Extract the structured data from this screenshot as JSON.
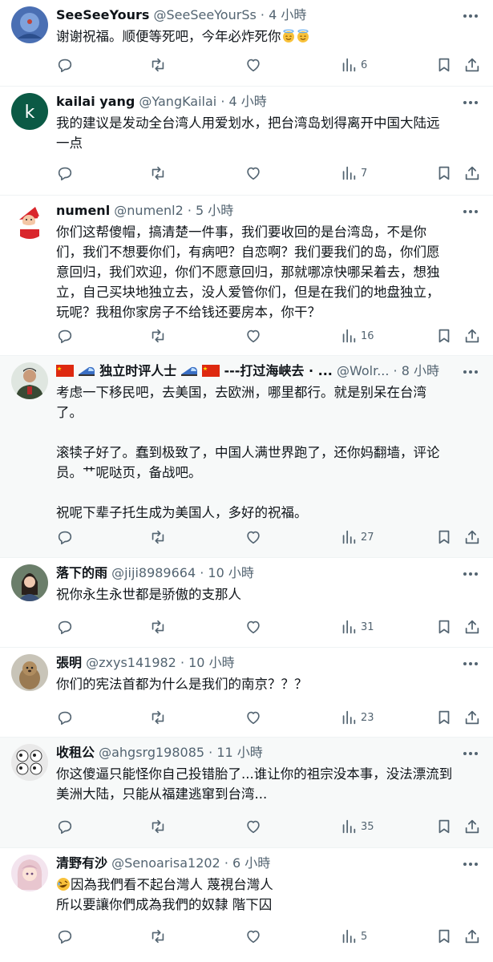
{
  "colors": {
    "text": "#0f1419",
    "secondary": "#536471",
    "divider": "#eff3f4",
    "shaded_bg": "#f7f9f9"
  },
  "icons": {
    "reply": "reply-icon",
    "retweet": "retweet-icon",
    "like": "heart-icon",
    "views": "views-icon",
    "bookmark": "bookmark-icon",
    "share": "share-icon",
    "more": "more-icon"
  },
  "posts": [
    {
      "name": "SeeSeeYours",
      "handle": "@SeeSeeYourSs",
      "time": "4 小時",
      "lines": [
        "谢谢祝福。顺便等死吧，今年必炸死你"
      ],
      "views": "6"
    },
    {
      "name": "kailai yang",
      "handle": "@YangKailai",
      "time": "4 小時",
      "avatar_letter": "k",
      "lines": [
        "我的建议是发动全台湾人用爱划水，把台湾岛划得离开中国大陆远\n一点"
      ],
      "views": "7"
    },
    {
      "name": "numenl",
      "handle": "@numenl2",
      "time": "5 小時",
      "lines": [
        "你们这帮傻帽，搞清楚一件事，我们要收回的是台湾岛，不是你\n们，我们不想要你们，有病吧？自恋啊？我们要我们的岛，你们愿\n意回归，我们欢迎，你们不愿意回归，那就哪凉快哪呆着去，想独\n立，自己买块地独立去，没人爱管你们，但是在我们的地盘独立，\n玩呢？我租你家房子不给钱还要房本，你干？"
      ],
      "views": "16"
    },
    {
      "name": "独立时评人士",
      "name_suffix": "---打过海峡去 · ...",
      "handle": "@Wolr...",
      "time": "8 小時",
      "lines": [
        "考虑一下移民吧，去美国，去欧洲，哪里都行。就是别呆在台湾\n了。",
        "滚犊子好了。蠢到极致了，中国人满世界跑了，还你妈翻墙，评论\n员。艹呢哒页，备战吧。",
        "祝呢下辈子托生成为美国人，多好的祝福。"
      ],
      "views": "27"
    },
    {
      "name": "落下的雨",
      "handle": "@jiji8989664",
      "time": "10 小時",
      "lines": [
        "祝你永生永世都是骄傲的支那人"
      ],
      "views": "31"
    },
    {
      "name": "張明",
      "handle": "@zxys141982",
      "time": "10 小時",
      "lines": [
        "你们的宪法首都为什么是我们的南京？？？"
      ],
      "views": "23"
    },
    {
      "name": "收租公",
      "handle": "@ahgsrg198085",
      "time": "11 小時",
      "lines": [
        "你这傻逼只能怪你自己投错胎了...谁让你的祖宗没本事，没法漂流到\n美洲大陆，只能从福建逃窜到台湾..."
      ],
      "views": "35"
    },
    {
      "name": "清野有沙",
      "handle": "@Senoarisa1202",
      "time": "6 小時",
      "lines": [
        "因為我們看不起台灣人 蔑視台灣人\n所以要讓你們成為我們的奴隸 階下囚"
      ],
      "views": "5"
    }
  ]
}
